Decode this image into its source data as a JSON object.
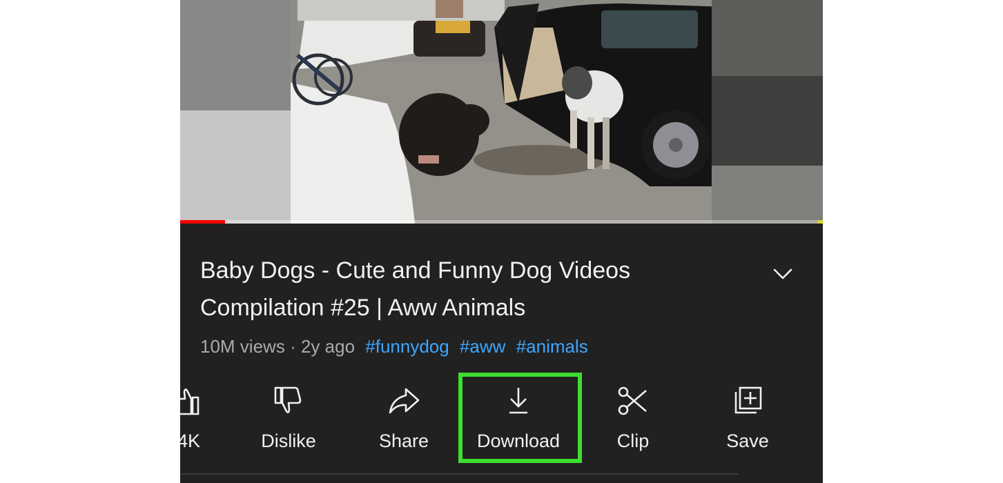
{
  "video": {
    "progress_fraction": 0.07
  },
  "title": "Baby Dogs - Cute and Funny Dog Videos Compilation #25 | Aww Animals",
  "meta": {
    "views": "10M views",
    "separator": "·",
    "age": "2y ago",
    "hashtags": [
      "#funnydog",
      "#aww",
      "#animals"
    ]
  },
  "actions": [
    {
      "label": "4K",
      "icon": "thumb-up-icon"
    },
    {
      "label": "Dislike",
      "icon": "thumb-down-icon"
    },
    {
      "label": "Share",
      "icon": "share-icon"
    },
    {
      "label": "Download",
      "icon": "download-icon"
    },
    {
      "label": "Clip",
      "icon": "scissors-icon"
    },
    {
      "label": "Save",
      "icon": "add-to-playlist-icon"
    }
  ],
  "colors": {
    "highlight": "#3cde2f",
    "hashtag": "#3ea6ff",
    "progress": "#ff0000",
    "background": "#212121"
  }
}
